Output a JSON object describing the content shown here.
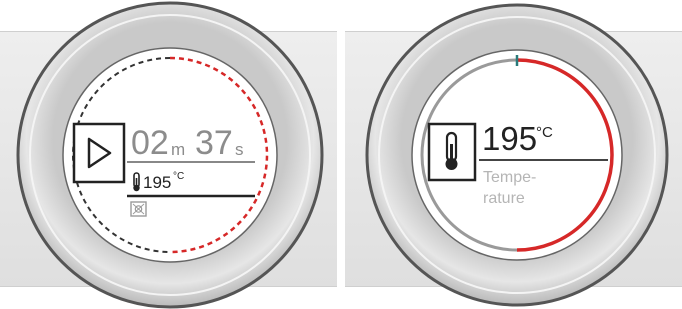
{
  "left_dial": {
    "timer": {
      "minutes": "02",
      "minutes_unit": "m",
      "seconds": "37",
      "seconds_unit": "s"
    },
    "temperature": {
      "value": "195",
      "unit": "°C"
    },
    "icons": {
      "mode": "play-icon",
      "temp": "thermometer-icon",
      "function": "oven-function-icon"
    },
    "accent_color": "#d62828"
  },
  "right_dial": {
    "temperature": {
      "value": "195",
      "unit": "°C"
    },
    "label_line1": "Tempe-",
    "label_line2": "rature",
    "icons": {
      "temp": "thermometer-icon"
    },
    "progress_fraction": 0.5,
    "accent_color": "#d62828"
  }
}
